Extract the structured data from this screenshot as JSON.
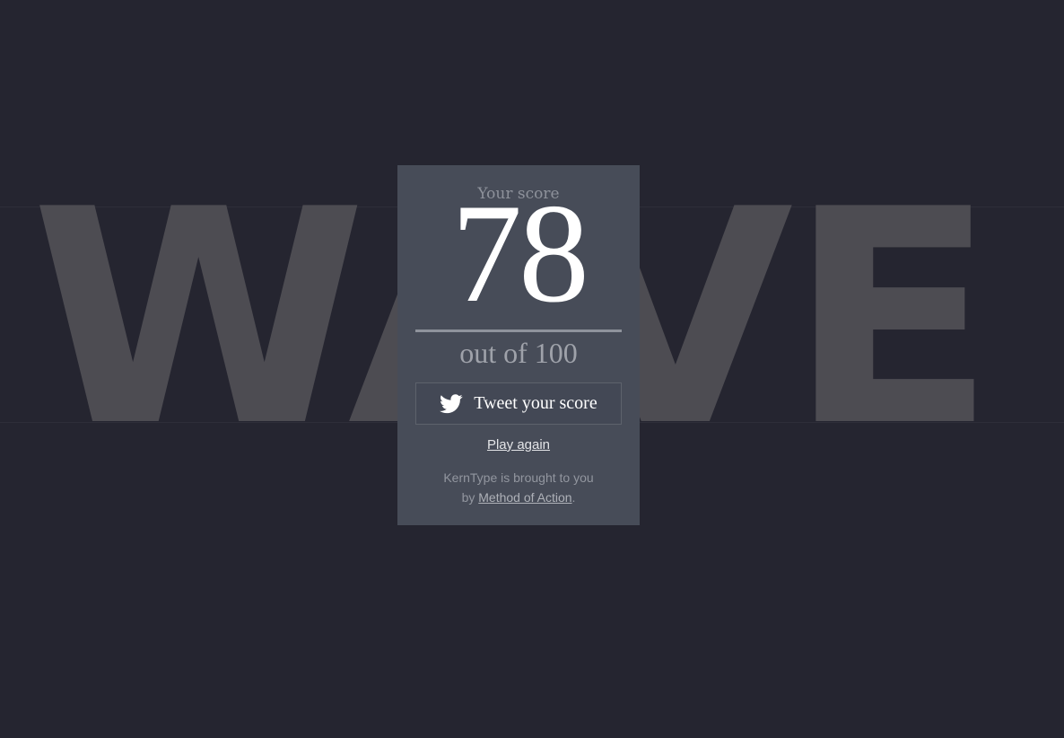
{
  "game": {
    "word": "WAVE"
  },
  "score_card": {
    "heading": "Your score",
    "score": "78",
    "max_label": "out of 100",
    "tweet_label": "Tweet your score",
    "play_again_label": "Play again",
    "credits_prefix": "KernType is brought to you",
    "credits_by": "by ",
    "credits_link": "Method of Action",
    "credits_suffix": "."
  },
  "icons": {
    "tweet": "twitter-bird-icon"
  },
  "colors": {
    "background": "#252530",
    "card": "#474c58",
    "word": "#4d4c52",
    "score": "#ffffff"
  }
}
